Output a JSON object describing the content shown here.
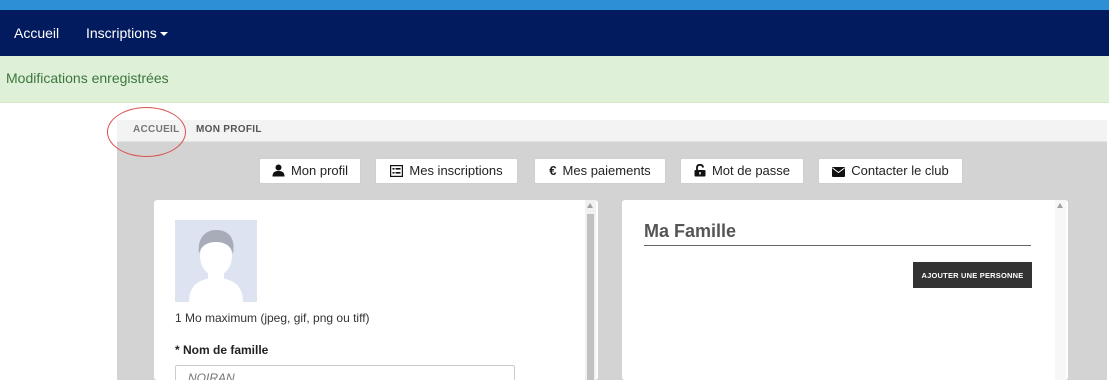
{
  "navbar": {
    "items": [
      {
        "label": "Accueil"
      },
      {
        "label": "Inscriptions"
      }
    ]
  },
  "alert": {
    "message": "Modifications enregistrées"
  },
  "breadcrumb": [
    {
      "label": "ACCUEIL"
    },
    {
      "label": "MON PROFIL"
    }
  ],
  "profile_tabs": [
    {
      "label": "Mon profil",
      "icon": "user-icon"
    },
    {
      "label": "Mes inscriptions",
      "icon": "list-icon"
    },
    {
      "label": "Mes paiements",
      "icon": "euro-icon"
    },
    {
      "label": "Mot de passe",
      "icon": "unlock-icon"
    },
    {
      "label": "Contacter le club",
      "icon": "envelope-icon"
    }
  ],
  "profile_form": {
    "photo_hint": "1 Mo maximum (jpeg, gif, png ou tiff)",
    "lastname_label": "* Nom de famille",
    "lastname_value": "NOIRAN"
  },
  "family": {
    "title": "Ma Famille",
    "add_button": "AJOUTER UNE PERSONNE"
  },
  "colors": {
    "navbar": "#021a5e",
    "top_accent": "#2d8fd6",
    "alert_bg": "#dff0d8",
    "alert_text": "#3c763d",
    "highlight_ring": "#d9534f",
    "dark_button": "#333333"
  }
}
